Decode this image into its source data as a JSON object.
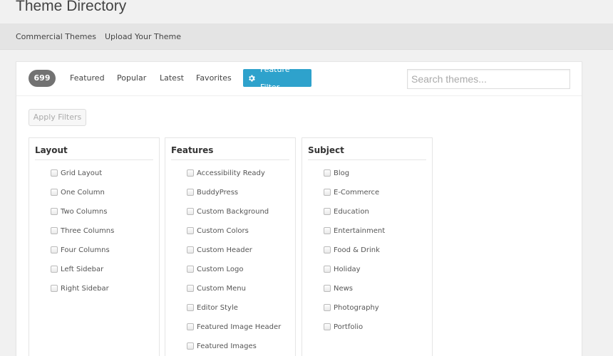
{
  "header": {
    "title": "Theme Directory"
  },
  "subnav": {
    "links": [
      "Commercial Themes",
      "Upload Your Theme"
    ]
  },
  "filter_bar": {
    "count": "699",
    "links": [
      "Featured",
      "Popular",
      "Latest",
      "Favorites"
    ],
    "feature_filter_label": "Feature Filter",
    "feature_filter_icon": "gear-icon",
    "search_placeholder": "Search themes..."
  },
  "apply_filters_label": "Apply Filters",
  "groups": [
    {
      "title": "Layout",
      "items": [
        "Grid Layout",
        "One Column",
        "Two Columns",
        "Three Columns",
        "Four Columns",
        "Left Sidebar",
        "Right Sidebar"
      ]
    },
    {
      "title": "Features",
      "items": [
        "Accessibility Ready",
        "BuddyPress",
        "Custom Background",
        "Custom Colors",
        "Custom Header",
        "Custom Logo",
        "Custom Menu",
        "Editor Style",
        "Featured Image Header",
        "Featured Images"
      ]
    },
    {
      "title": "Subject",
      "items": [
        "Blog",
        "E-Commerce",
        "Education",
        "Entertainment",
        "Food & Drink",
        "Holiday",
        "News",
        "Photography",
        "Portfolio"
      ]
    }
  ],
  "colors": {
    "accent": "#2ea2cc",
    "badge": "#727272",
    "subnav_bg": "#e4e4e4"
  }
}
